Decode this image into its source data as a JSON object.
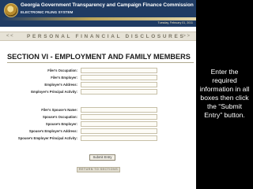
{
  "header": {
    "org_title": "Georgia Government Transparency and Campaign Finance Commission",
    "system_name": "ELECTRONIC FILING SYSTEM",
    "date": "Tuesday, February 01, 2011"
  },
  "nav": {
    "title": "PERSONAL FINANCIAL DISCLOSURES",
    "prev_icon": "double-chevron-left-icon",
    "next_icon": "double-chevron-right-icon"
  },
  "section": {
    "title": "SECTION VI - EMPLOYMENT AND FAMILY MEMBERS"
  },
  "filer_fields": [
    {
      "label": "Filer's Occupation:",
      "value": ""
    },
    {
      "label": "Filer's Employer:",
      "value": ""
    },
    {
      "label": "Employer's Address:",
      "value": ""
    },
    {
      "label": "Employer's Principal Activity:",
      "value": ""
    }
  ],
  "spouse_fields": [
    {
      "label": "Filer's Spouse's Name:",
      "value": ""
    },
    {
      "label": "Spouse's Occupation:",
      "value": ""
    },
    {
      "label": "Spouse's Employer:",
      "value": ""
    },
    {
      "label": "Spouse's Employer's Address:",
      "value": ""
    },
    {
      "label": "Spouse's Employer Principal Activity:",
      "value": ""
    }
  ],
  "buttons": {
    "submit": "Submit Entry",
    "return": "RETURN TO SECTIONS"
  },
  "callout": {
    "text": "Enter the required information in all boxes then click the “Submit Entry” button."
  },
  "colors": {
    "header_bg": "#1f3b63",
    "gold": "#b8a257",
    "nav_bg": "#e6e2d6",
    "callout_bg": "#000000"
  }
}
